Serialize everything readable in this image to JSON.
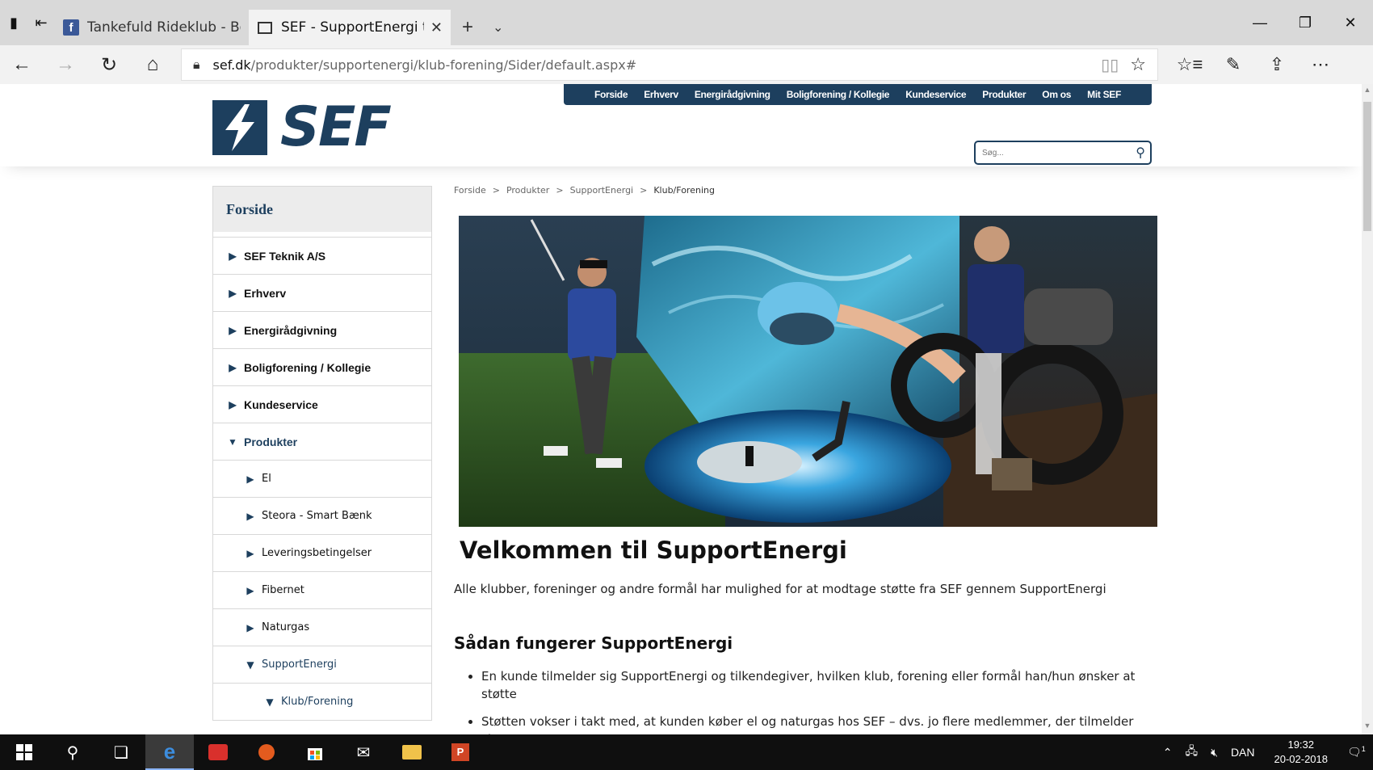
{
  "browser": {
    "tabs": [
      {
        "title": "Tankefuld Rideklub - Begive",
        "active": false
      },
      {
        "title": "SEF - SupportEnergi til (",
        "active": true
      }
    ],
    "url": {
      "host": "sef.dk",
      "path": "/produkter/supportenergi/klub-forening/Sider/default.aspx#"
    }
  },
  "site": {
    "logo_text": "SEF",
    "topnav": [
      "Forside",
      "Erhverv",
      "Energirådgivning",
      "Boligforening / Kollegie",
      "Kundeservice",
      "Produkter",
      "Om os",
      "Mit SEF"
    ],
    "search_placeholder": "Søg..."
  },
  "sidebar": {
    "header": "Forside",
    "items": [
      {
        "label": "SEF Teknik A/S",
        "level": 1,
        "open": false
      },
      {
        "label": "Erhverv",
        "level": 1,
        "open": false
      },
      {
        "label": "Energirådgivning",
        "level": 1,
        "open": false
      },
      {
        "label": "Boligforening / Kollegie",
        "level": 1,
        "open": false
      },
      {
        "label": "Kundeservice",
        "level": 1,
        "open": false
      },
      {
        "label": "Produkter",
        "level": 1,
        "open": true
      },
      {
        "label": "El",
        "level": 2,
        "open": false
      },
      {
        "label": "Steora - Smart Bænk",
        "level": 2,
        "open": false
      },
      {
        "label": "Leveringsbetingelser",
        "level": 2,
        "open": false
      },
      {
        "label": "Fibernet",
        "level": 2,
        "open": false
      },
      {
        "label": "Naturgas",
        "level": 2,
        "open": false
      },
      {
        "label": "SupportEnergi",
        "level": 2,
        "open": true
      },
      {
        "label": "Klub/Forening",
        "level": 3,
        "open": true
      }
    ]
  },
  "breadcrumb": [
    "Forside",
    "Produkter",
    "SupportEnergi",
    "Klub/Forening"
  ],
  "content": {
    "title": "Velkommen til SupportEnergi",
    "intro": "Alle klubber, foreninger og andre formål har mulighed for at modtage støtte fra SEF gennem SupportEnergi",
    "section_title": "Sådan fungerer SupportEnergi",
    "bullets": [
      "En kunde tilmelder sig SupportEnergi og tilkendegiver, hvilken klub, forening eller formål han/hun ønsker at støtte",
      "Støtten vokser i takt med, at kunden køber el og naturgas hos SEF – dvs. jo flere medlemmer, der tilmelder sig"
    ]
  },
  "taskbar": {
    "language": "DAN",
    "time": "19:32",
    "date": "20-02-2018",
    "notification_count": "1"
  },
  "colors": {
    "brand": "#1d3f5e"
  }
}
